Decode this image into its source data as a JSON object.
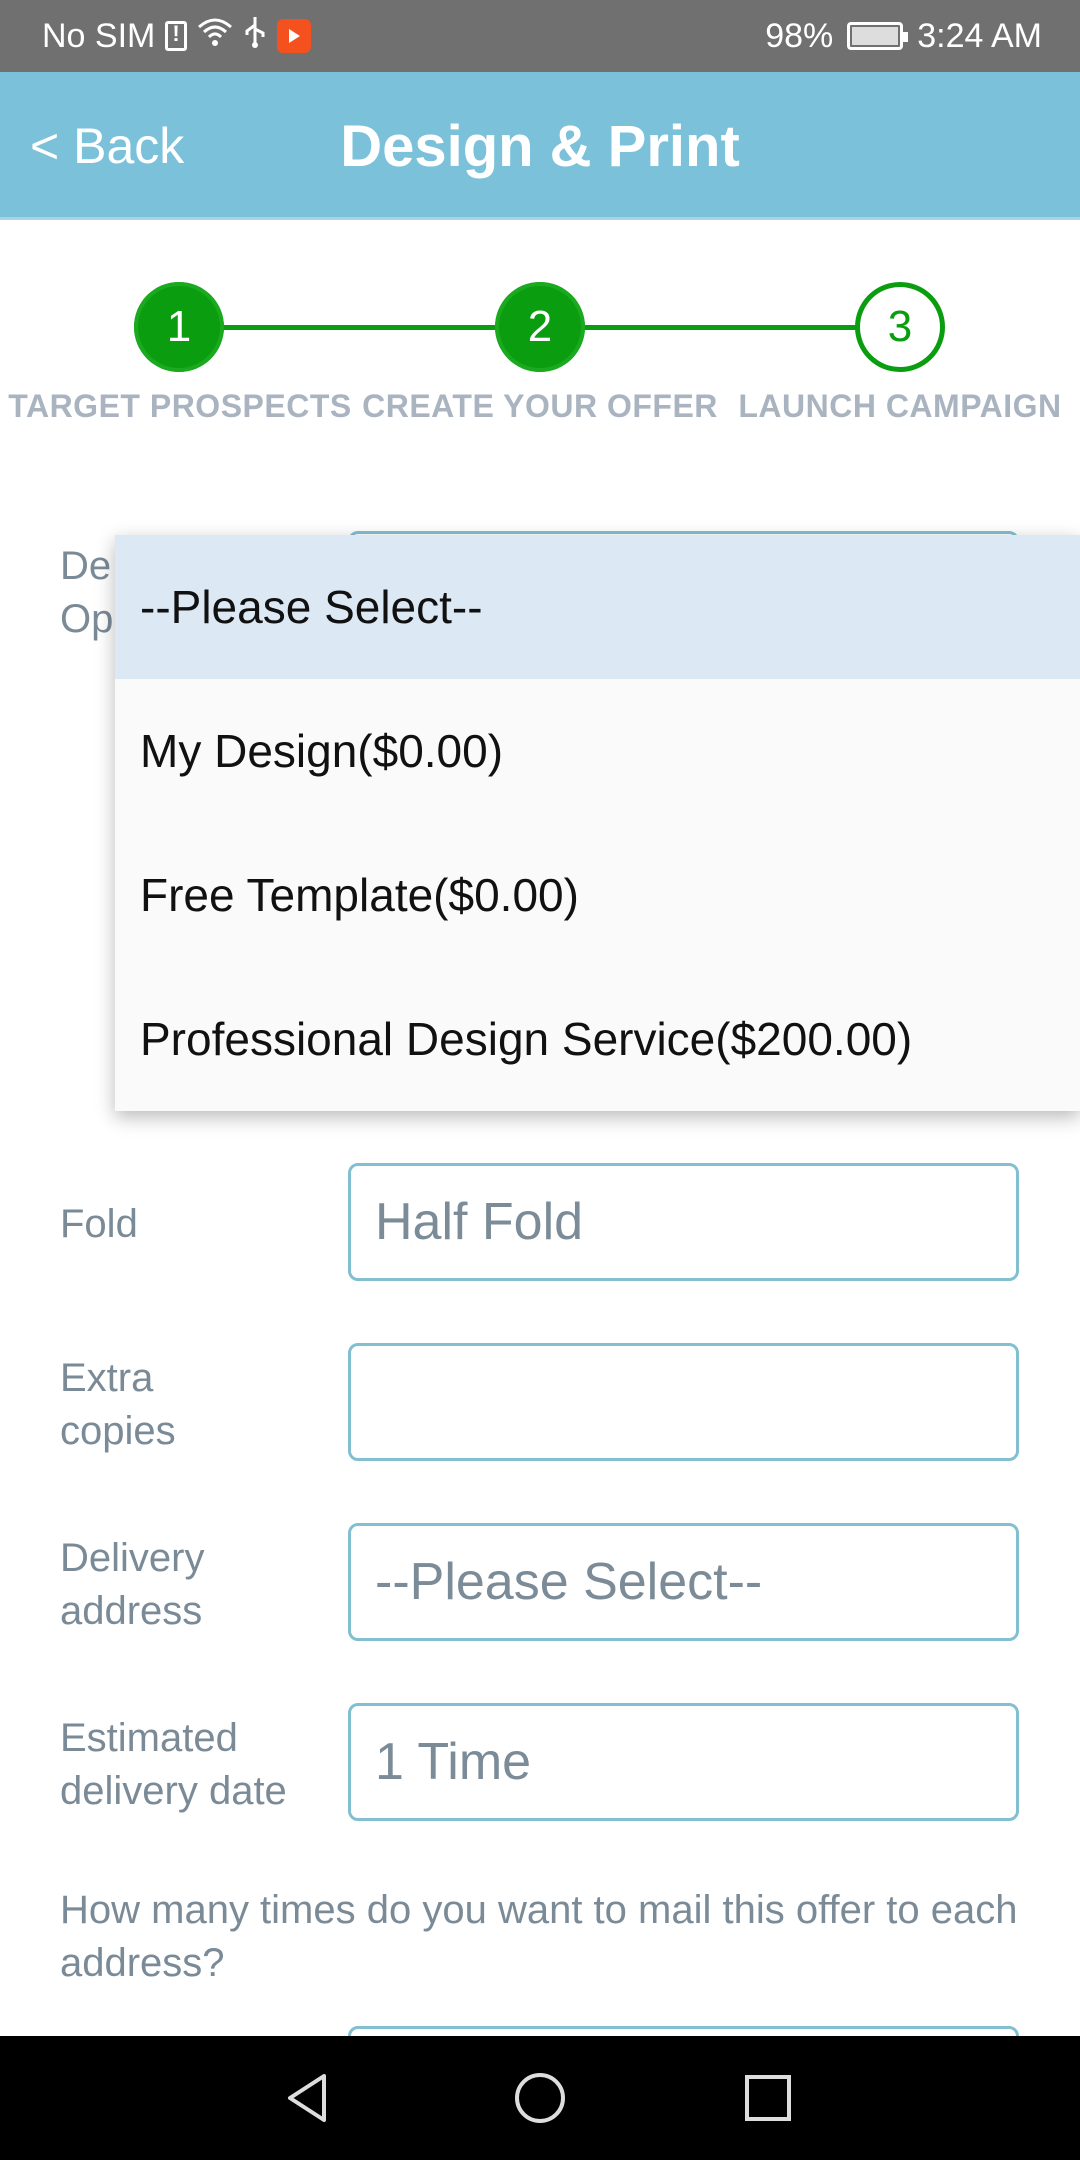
{
  "status_bar": {
    "carrier": "No SIM",
    "battery": "98%",
    "time": "3:24 AM"
  },
  "header": {
    "back_label": "< Back",
    "title": "Design & Print"
  },
  "stepper": {
    "steps": [
      {
        "number": "1",
        "label": "TARGET PROSPECTS",
        "state": "done"
      },
      {
        "number": "2",
        "label": "CREATE YOUR OFFER",
        "state": "done"
      },
      {
        "number": "3",
        "label": "LAUNCH CAMPAIGN",
        "state": "current"
      }
    ],
    "active_color": "#0b9d10"
  },
  "form": {
    "design_option": {
      "label_line1": "De",
      "label_line2": "Op"
    },
    "fold": {
      "label": "Fold",
      "value": "Half Fold"
    },
    "extra_copies": {
      "label_line1": "Extra",
      "label_line2": "copies",
      "value": ""
    },
    "delivery_address": {
      "label_line1": "Delivery",
      "label_line2": "address",
      "value": "--Please Select--"
    },
    "delivery_date": {
      "label_line1": "Estimated",
      "label_line2": "delivery date",
      "value": "1 Time"
    },
    "mail_times_question": "How many times do you want to mail this offer to each address?"
  },
  "dropdown": {
    "options": [
      {
        "label": "--Please Select--",
        "selected": true
      },
      {
        "label": "My Design($0.00)",
        "selected": false
      },
      {
        "label": "Free Template($0.00)",
        "selected": false
      },
      {
        "label": "Professional Design Service($200.00)",
        "selected": false
      }
    ]
  },
  "colors": {
    "header_bg": "#7cc1da",
    "field_border": "#82bfd1",
    "label_text": "#7a8a96"
  }
}
